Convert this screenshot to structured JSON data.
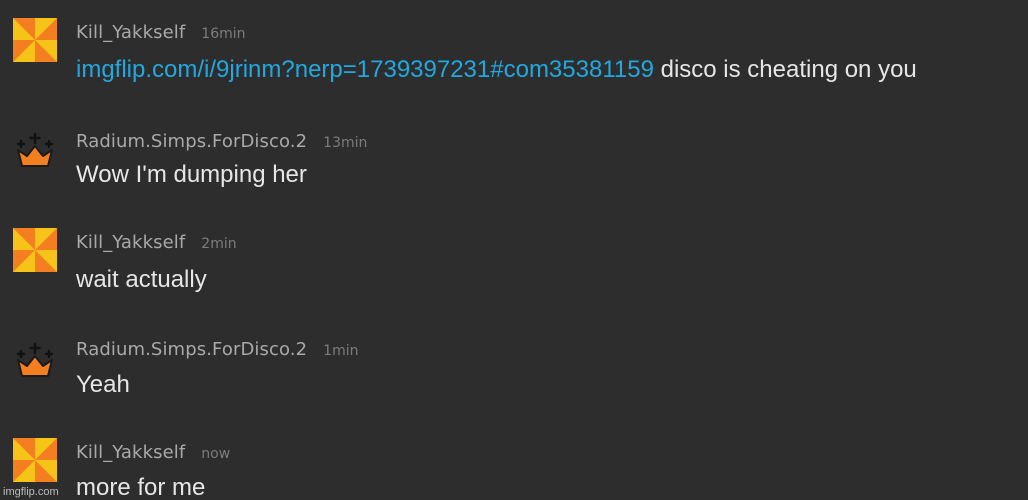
{
  "comments": [
    {
      "username": "Kill_Yakkself",
      "time": "16min",
      "avatar_icon": "pinwheel-icon",
      "link": "imgflip.com/i/9jrinm?nerp=1739397231#com35381159",
      "text": "disco is cheating on you"
    },
    {
      "username": "Radium.Simps.ForDisco.2",
      "time": "13min",
      "avatar_icon": "crown-icon",
      "text": "Wow I'm dumping her"
    },
    {
      "username": "Kill_Yakkself",
      "time": "2min",
      "avatar_icon": "pinwheel-icon",
      "text": "wait actually"
    },
    {
      "username": "Radium.Simps.ForDisco.2",
      "time": "1min",
      "avatar_icon": "crown-icon",
      "text": "Yeah"
    },
    {
      "username": "Kill_Yakkself",
      "time": "now",
      "avatar_icon": "pinwheel-icon",
      "text": "more for me"
    }
  ],
  "watermark": "imgflip.com",
  "colors": {
    "background": "#2d2d2d",
    "username": "#a9a9a9",
    "timestamp": "#7c7c7c",
    "text": "#e6e6e6",
    "link": "#21a8e0",
    "pinwheel_yellow": "#f6c319",
    "pinwheel_orange": "#f47f20",
    "crown_orange": "#f47f20"
  }
}
